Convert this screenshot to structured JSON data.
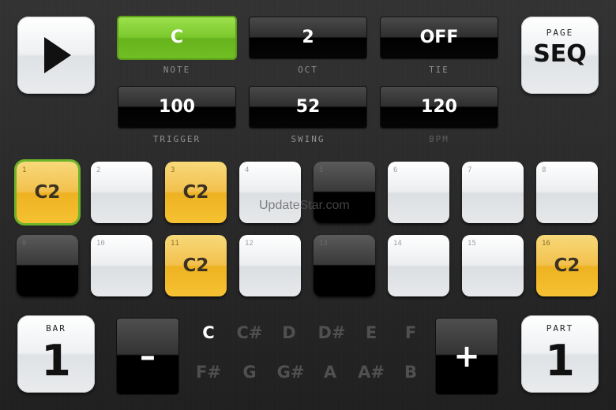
{
  "transport": {
    "play_icon": "play-icon"
  },
  "page_button": {
    "small": "PAGE",
    "big": "SEQ"
  },
  "params": [
    {
      "id": "note",
      "value": "C",
      "label": "NOTE",
      "active": true
    },
    {
      "id": "oct",
      "value": "2",
      "label": "OCT",
      "active": false
    },
    {
      "id": "tie",
      "value": "OFF",
      "label": "TIE",
      "active": false
    },
    {
      "id": "trigger",
      "value": "100",
      "label": "TRIGGER",
      "active": false
    },
    {
      "id": "swing",
      "value": "52",
      "label": "SWING",
      "active": false
    },
    {
      "id": "bpm",
      "value": "120",
      "label": "BPM",
      "active": false
    }
  ],
  "steps": [
    {
      "num": "1",
      "note": "C2",
      "state": "on",
      "selected": true
    },
    {
      "num": "2",
      "note": "",
      "state": "off"
    },
    {
      "num": "3",
      "note": "C2",
      "state": "on"
    },
    {
      "num": "4",
      "note": "",
      "state": "off"
    },
    {
      "num": "5",
      "note": "",
      "state": "rest"
    },
    {
      "num": "6",
      "note": "",
      "state": "off"
    },
    {
      "num": "7",
      "note": "",
      "state": "off"
    },
    {
      "num": "8",
      "note": "",
      "state": "off"
    },
    {
      "num": "9",
      "note": "",
      "state": "rest"
    },
    {
      "num": "10",
      "note": "",
      "state": "off"
    },
    {
      "num": "11",
      "note": "C2",
      "state": "on"
    },
    {
      "num": "12",
      "note": "",
      "state": "off"
    },
    {
      "num": "13",
      "note": "",
      "state": "rest"
    },
    {
      "num": "14",
      "note": "",
      "state": "off"
    },
    {
      "num": "15",
      "note": "",
      "state": "off"
    },
    {
      "num": "16",
      "note": "C2",
      "state": "on"
    }
  ],
  "watermark": "UpdateStar.com",
  "bar": {
    "small": "BAR",
    "value": "1"
  },
  "part": {
    "small": "PART",
    "value": "1"
  },
  "minus_label": "–",
  "plus_label": "+",
  "note_picker": {
    "row1": [
      "C",
      "C#",
      "D",
      "D#",
      "E",
      "F"
    ],
    "row2": [
      "F#",
      "G",
      "G#",
      "A",
      "A#",
      "B"
    ],
    "selected": "C"
  },
  "colors": {
    "accent_green": "#7cc92d",
    "step_on_yellow": "#f2c14e",
    "step_off_white": "#eceef0",
    "step_rest_black": "#000000"
  }
}
